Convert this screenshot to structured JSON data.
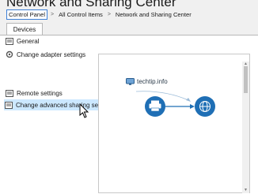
{
  "window": {
    "title": "Network and Sharing Center"
  },
  "breadcrumb": {
    "items": [
      "Control Panel",
      "All Control Items",
      "Network and Sharing Center"
    ],
    "separator": ">"
  },
  "tabs": {
    "devices": "Devices"
  },
  "left": {
    "general": "General",
    "adapter": "Change adapter settings",
    "remote": "Remote settings",
    "advanced": "Change advanced sharing settings"
  },
  "graphic": {
    "brand": "techtip.info",
    "icons": [
      "printer-icon",
      "globe-icon"
    ]
  },
  "colors": {
    "accent": "#1f6fb5",
    "highlight": "#cce8ff"
  }
}
